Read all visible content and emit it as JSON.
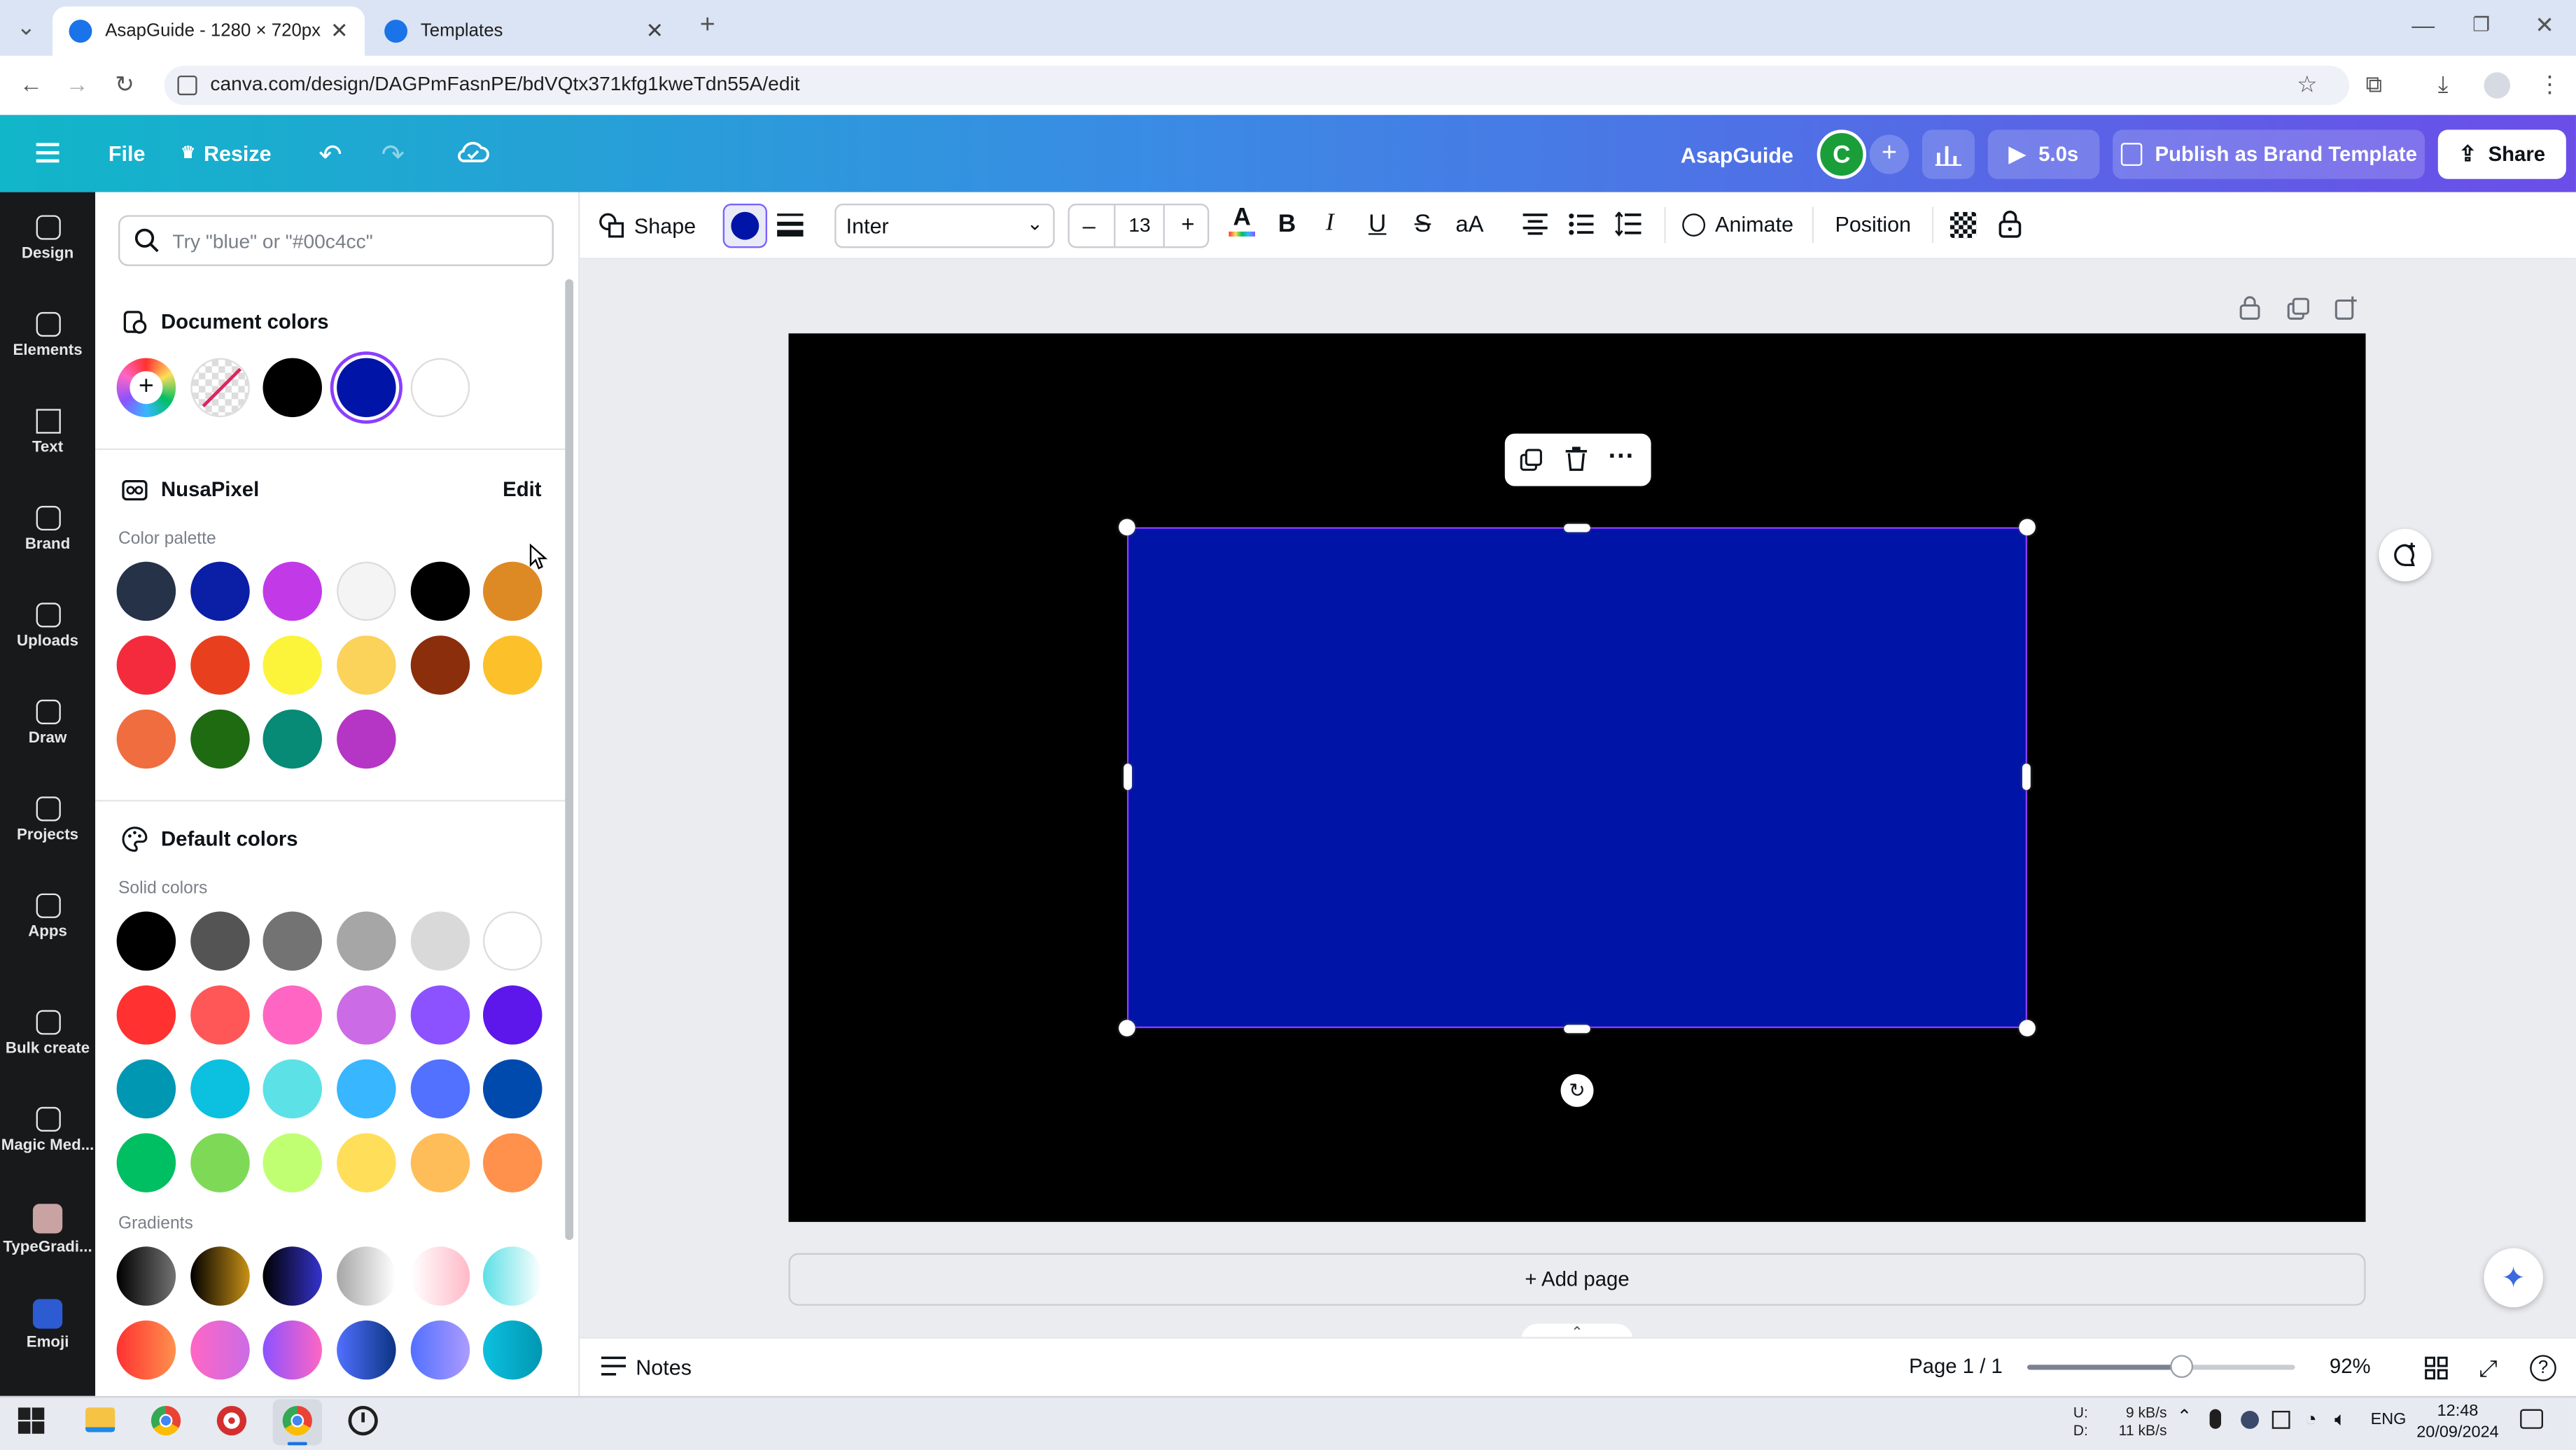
{
  "browser": {
    "tabs": [
      {
        "title": "AsapGuide - 1280 × 720px",
        "active": true
      },
      {
        "title": "Templates",
        "active": false
      }
    ],
    "url": "canva.com/design/DAGPmFasnPE/bdVQtx371kfg1kweTdn55A/edit"
  },
  "header": {
    "file_label": "File",
    "resize_label": "Resize",
    "doc_name": "AsapGuide",
    "avatar_letter": "C",
    "play_label": "5.0s",
    "publish_label": "Publish as Brand Template",
    "share_label": "Share"
  },
  "sidebar": {
    "items": [
      {
        "label": "Design",
        "icon": "layout-icon"
      },
      {
        "label": "Elements",
        "icon": "shapes-icon"
      },
      {
        "label": "Text",
        "icon": "text-icon"
      },
      {
        "label": "Brand",
        "icon": "brand-icon"
      },
      {
        "label": "Uploads",
        "icon": "cloud-upload-icon"
      },
      {
        "label": "Draw",
        "icon": "pen-icon"
      },
      {
        "label": "Projects",
        "icon": "folder-icon"
      },
      {
        "label": "Apps",
        "icon": "grid-icon"
      },
      {
        "label": "Bulk create",
        "icon": "bulk-icon"
      },
      {
        "label": "Magic Med...",
        "icon": "magic-media-icon"
      },
      {
        "label": "TypeGradi...",
        "icon": "typegradient-icon"
      },
      {
        "label": "Emoji",
        "icon": "emoji-icon"
      }
    ]
  },
  "color_panel": {
    "search_placeholder": "Try \"blue\" or \"#00c4cc\"",
    "document_colors_title": "Document colors",
    "document_colors": [
      "rainbow-add",
      "transparent",
      "#000000",
      "#0014a8",
      "#ffffff"
    ],
    "brand_kit_title": "NusaPixel",
    "brand_kit_edit": "Edit",
    "palette_label": "Color palette",
    "palette": [
      "#263247",
      "#0b1ea6",
      "#c23ae8",
      "#f4f4f4",
      "#000000",
      "#dd8a25",
      "#f42b3c",
      "#e8401e",
      "#fbf43a",
      "#fbd25a",
      "#8b2e0c",
      "#fbc02a",
      "#ef6d3f",
      "#1f6b12",
      "#078a76",
      "#b535c5"
    ],
    "default_colors_title": "Default colors",
    "solid_label": "Solid colors",
    "solid": [
      "#000000",
      "#545454",
      "#737373",
      "#a6a6a6",
      "#d9d9d9",
      "#ffffff",
      "#ff3131",
      "#ff5757",
      "#ff66c4",
      "#cb6ce6",
      "#8c52ff",
      "#5e17eb",
      "#0097b2",
      "#0cc0df",
      "#5ce1e6",
      "#38b6ff",
      "#5271ff",
      "#004aad",
      "#00bf63",
      "#7ed957",
      "#c1ff72",
      "#ffde59",
      "#ffbd59",
      "#ff914d"
    ],
    "gradients_label": "Gradients",
    "gradients": [
      [
        "#000000",
        "#737373"
      ],
      [
        "#000000",
        "#c89116"
      ],
      [
        "#000000",
        "#3533cd"
      ],
      [
        "#a6a6a6",
        "#ffffff"
      ],
      [
        "#ffffff",
        "#ffb9c7"
      ],
      [
        "#5de0e6",
        "#ffffff"
      ],
      [
        "#ff3131",
        "#ff914d"
      ],
      [
        "#ff66c4",
        "#cb6ce6"
      ],
      [
        "#8c52ff",
        "#ff66c4"
      ],
      [
        "#5170ff",
        "#0c3483"
      ],
      [
        "#5170ff",
        "#ad9bff"
      ],
      [
        "#0cc0df",
        "#0097b2"
      ]
    ]
  },
  "toolbar": {
    "shape_label": "Shape",
    "fill_color": "#0014a8",
    "font": "Inter",
    "font_size": "13",
    "animate_label": "Animate",
    "position_label": "Position"
  },
  "canvas": {
    "background": "#000000",
    "shape_fill": "#0014a8",
    "add_page_label": "+ Add page"
  },
  "bottom": {
    "notes_label": "Notes",
    "page_label": "Page 1 / 1",
    "zoom_level": 0.92,
    "zoom_label": "92%"
  },
  "taskbar": {
    "net_up_label": "U:",
    "net_down_label": "D:",
    "net_up": "9 kB/s",
    "net_down": "11 kB/s",
    "lang": "ENG",
    "time": "12:48",
    "date": "20/09/2024"
  }
}
